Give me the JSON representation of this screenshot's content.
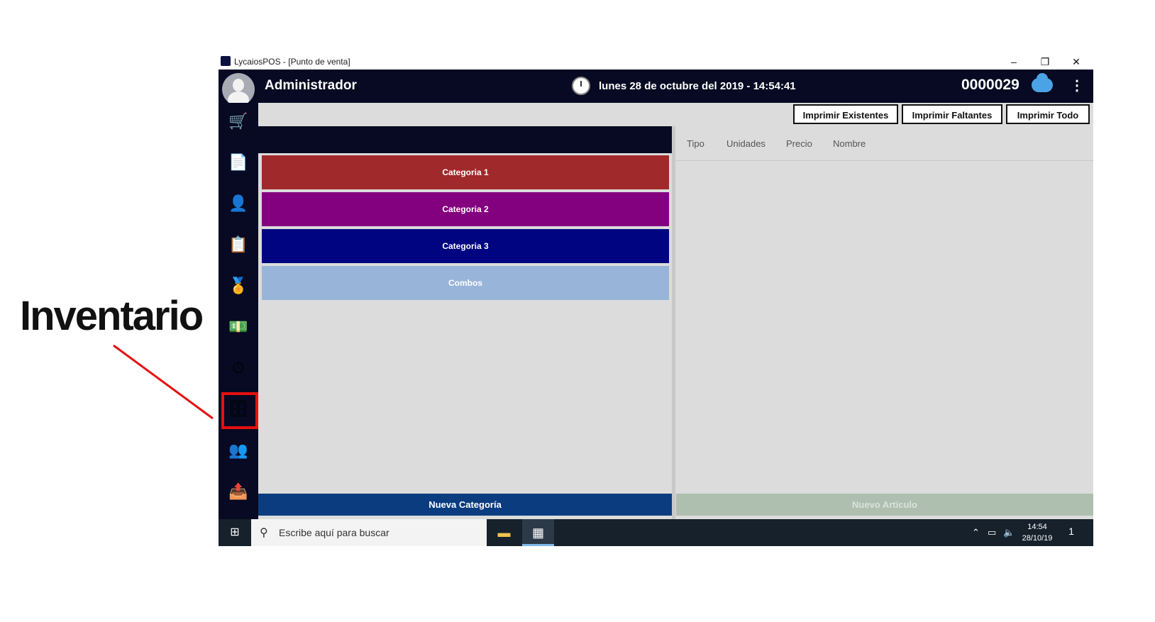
{
  "annotation": {
    "label": "Inventario",
    "highlight_color": "#e51010"
  },
  "window": {
    "title": "LycaiosPOS - [Punto de venta]",
    "controls": {
      "minimize": "–",
      "maximize": "❐",
      "close": "✕"
    }
  },
  "header": {
    "user": "Administrador",
    "datetime": "lunes 28 de octubre del 2019 - 14:54:41",
    "ticket_number": "0000029",
    "icons": [
      "avatar-icon",
      "clock-icon",
      "cloud-sync-icon",
      "more-vert-icon"
    ]
  },
  "sidebar": {
    "items": [
      {
        "name": "sales-cart",
        "glyph": "🛒"
      },
      {
        "name": "document",
        "glyph": "📄"
      },
      {
        "name": "customers",
        "glyph": "👤"
      },
      {
        "name": "reports-clock",
        "glyph": "📋"
      },
      {
        "name": "top-ribbon",
        "glyph": "🏅"
      },
      {
        "name": "cash-money",
        "glyph": "💵"
      },
      {
        "name": "timer",
        "glyph": "⏱"
      },
      {
        "name": "inventory",
        "glyph": "🗄"
      },
      {
        "name": "users",
        "glyph": "👥"
      },
      {
        "name": "exit",
        "glyph": "📤"
      }
    ],
    "selected": "inventory"
  },
  "toolbar": {
    "print_existing": "Imprimir Existentes",
    "print_missing": "Imprimir Faltantes",
    "print_all": "Imprimir Todo"
  },
  "categories": [
    {
      "label": "Categoria 1",
      "color": "#a0292b"
    },
    {
      "label": "Categoria 2",
      "color": "#83017f"
    },
    {
      "label": "Categoria 3",
      "color": "#000480"
    },
    {
      "label": "Combos",
      "color": "#98b4d8"
    }
  ],
  "table": {
    "columns": [
      "Tipo",
      "Unidades",
      "Precio",
      "Nombre"
    ]
  },
  "actions": {
    "new_category": "Nueva Categoría",
    "new_article": "Nuevo Artículo"
  },
  "taskbar": {
    "search_placeholder": "Escribe aquí para buscar",
    "time": "14:54",
    "date": "28/10/19",
    "notifications": "1"
  }
}
